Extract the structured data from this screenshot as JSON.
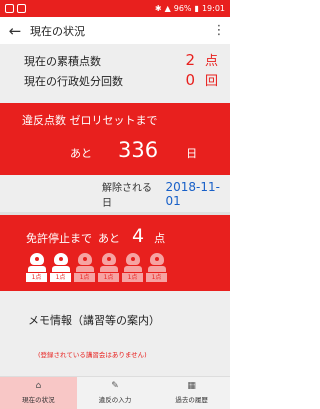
{
  "status_bar": {
    "battery": "96%",
    "time": "19:01"
  },
  "app_bar": {
    "back_icon": "arrow-back-icon",
    "title": "現在の状況",
    "menu_icon": "more-vert-icon"
  },
  "counts": [
    {
      "label": "現在の累積点数",
      "value": "2",
      "unit": "点"
    },
    {
      "label": "現在の行政処分回数",
      "value": "0",
      "unit": "回"
    }
  ],
  "reset": {
    "title": "違反点数 ゼロリセットまで",
    "prefix": "あと",
    "days": "336",
    "unit": "日"
  },
  "release": {
    "label": "解除される日",
    "date": "2018-11-01"
  },
  "suspension": {
    "title": "免許停止まで",
    "prefix": "あと",
    "points": "4",
    "unit": "点",
    "badges": [
      "1点",
      "1点",
      "1点",
      "1点",
      "1点",
      "1点"
    ],
    "filled_count": 2
  },
  "memo": {
    "title": "メモ情報（講習等の案内）",
    "note": "(登録されている講習会はありません)"
  },
  "tabs": [
    {
      "label": "現在の状況",
      "icon": "home-icon",
      "active": true
    },
    {
      "label": "違反の入力",
      "icon": "pencil-icon",
      "active": false
    },
    {
      "label": "過去の履歴",
      "icon": "calendar-icon",
      "active": false
    }
  ],
  "colors": {
    "accent": "#e8201e",
    "date": "#1860c8",
    "active_tab": "#f8c7c6"
  }
}
